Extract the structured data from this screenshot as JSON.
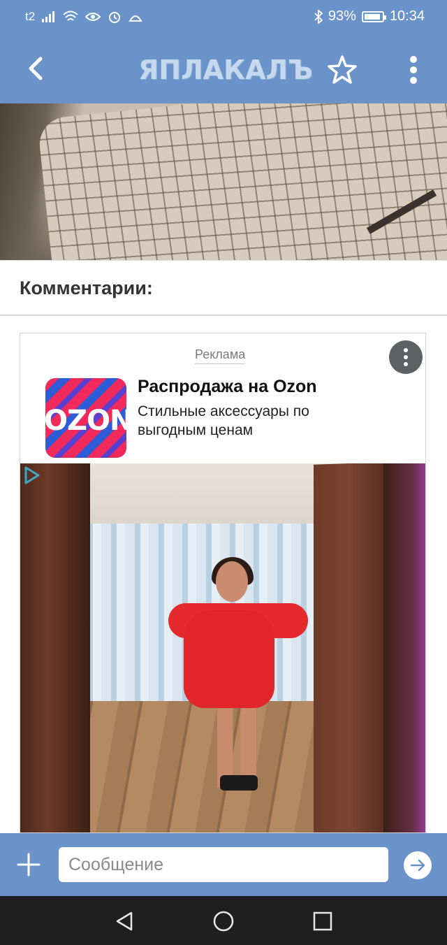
{
  "status_bar": {
    "carrier": "t2",
    "battery_percent": "93%",
    "battery_level": 0.93,
    "time": "10:34",
    "icons": [
      "signal-icon",
      "wifi-icon",
      "eye-icon",
      "alarm-icon",
      "android-icon",
      "bluetooth-icon",
      "battery-icon"
    ]
  },
  "app_bar": {
    "brand": "ЯПЛАКАЛЪ",
    "icons": [
      "back-icon",
      "star-icon",
      "more-vertical-icon"
    ]
  },
  "comments": {
    "title": "Комментарии:"
  },
  "ad": {
    "label": "Реклама",
    "logo_text": "OZON",
    "title": "Распродажа на Ozon",
    "subtitle": "Стильные аксессуары по выгодным ценам"
  },
  "message_bar": {
    "placeholder": "Сообщение",
    "value": ""
  },
  "colors": {
    "accent": "#6a93c9",
    "ozon_pink": "#f2295b",
    "ozon_blue": "#2e5bd8"
  }
}
